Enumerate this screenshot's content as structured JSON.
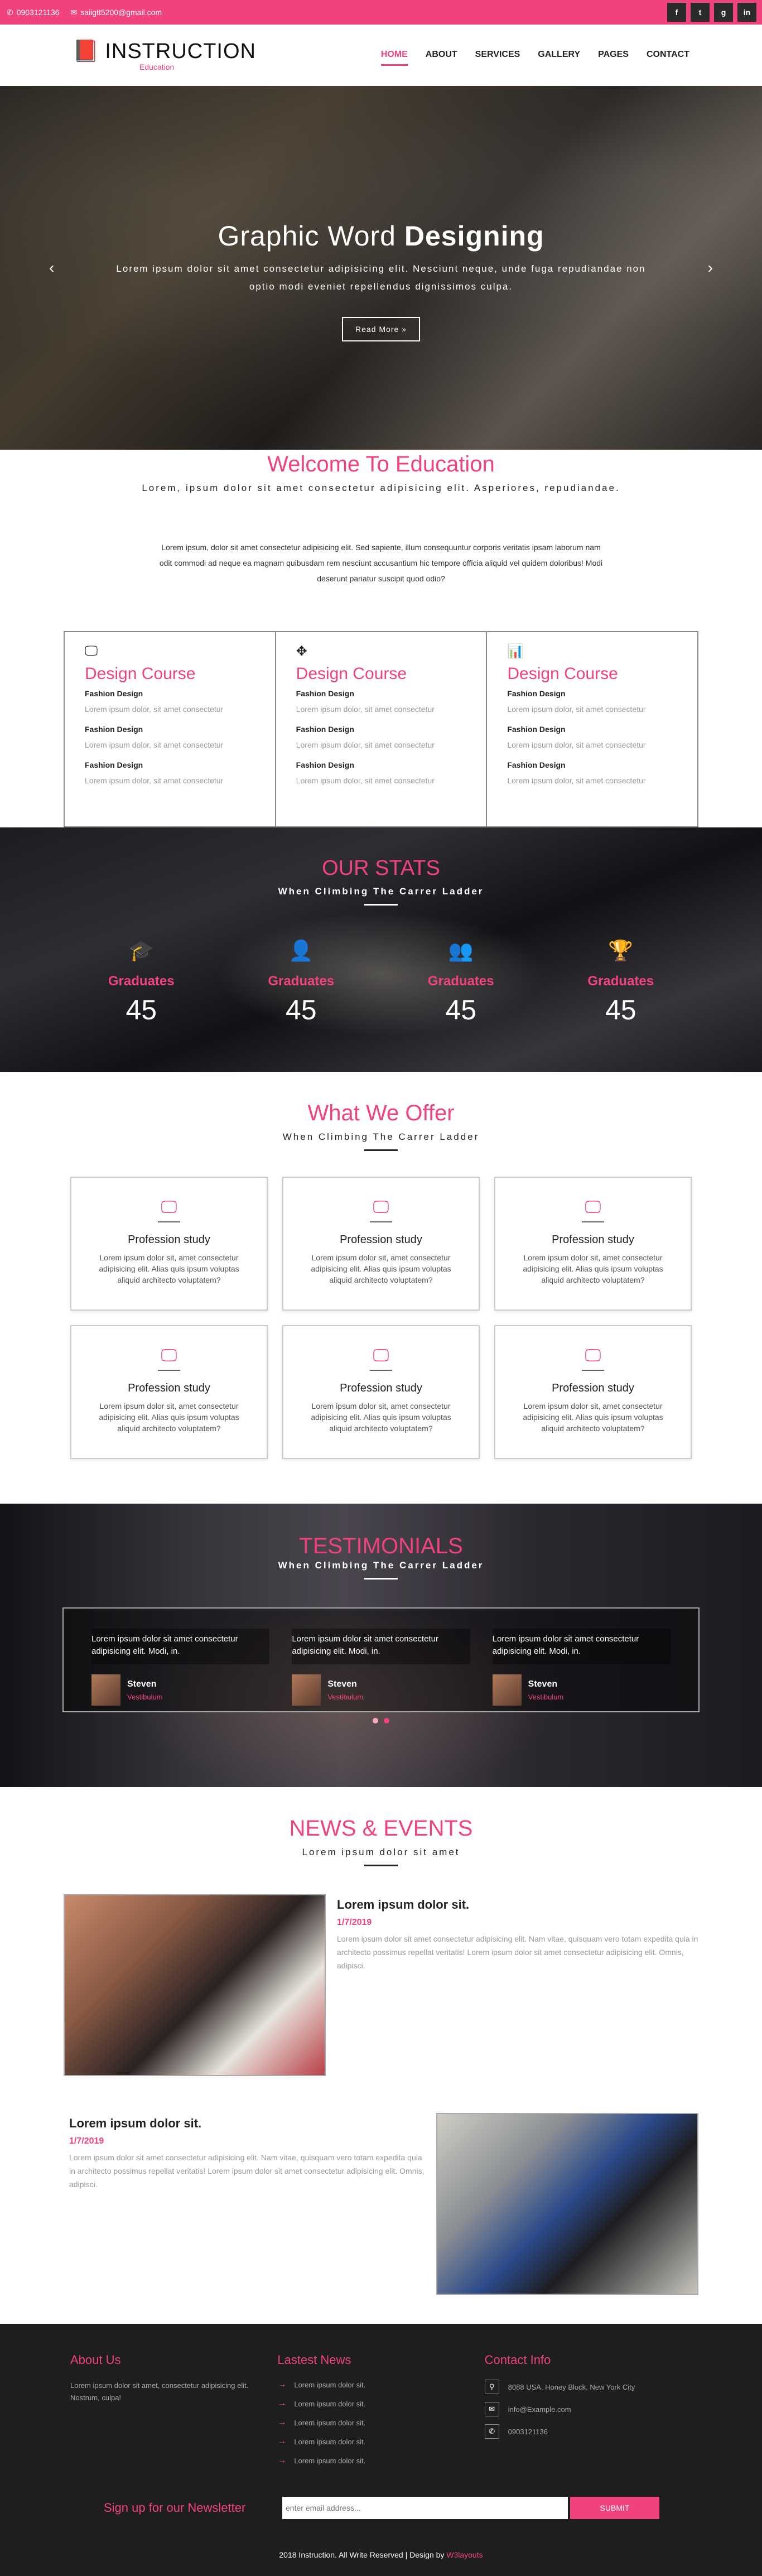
{
  "topbar": {
    "phone": "0903121136",
    "email": "saiigtt5200@gmail.com"
  },
  "social": [
    "f",
    "t",
    "g",
    "in"
  ],
  "logo": {
    "title": "INSTRUCTION",
    "subtitle": "Education"
  },
  "nav": [
    "HOME",
    "ABOUT",
    "SERVICES",
    "GALLERY",
    "PAGES",
    "CONTACT"
  ],
  "hero": {
    "title_a": "Graphic Word",
    "title_b": "Designing",
    "text": "Lorem ipsum dolor sit amet consectetur adipisicing elit. Nesciunt neque, unde fuga repudiandae non optio modi eveniet repellendus dignissimos culpa.",
    "button": "Read More »"
  },
  "welcome": {
    "title": "Welcome To Education",
    "tag": "Lorem, ipsum dolor sit amet consectetur adipisicing elit. Asperiores, repudiandae.",
    "desc": "Lorem ipsum, dolor sit amet consectetur adipisicing elit. Sed sapiente, illum consequuntur corporis veritatis ipsam laborum nam odit commodi ad neque ea magnam quibusdam rem nesciunt accusantium hic tempore officia aliquid vel quidem doloribus! Modi deserunt pariatur suscipit quod odio?"
  },
  "courses": [
    {
      "title": "Design Course",
      "items": [
        {
          "name": "Fashion Design",
          "text": "Lorem ipsum dolor, sit amet consectetur"
        },
        {
          "name": "Fashion Design",
          "text": "Lorem ipsum dolor, sit amet consectetur"
        },
        {
          "name": "Fashion Design",
          "text": "Lorem ipsum dolor, sit amet consectetur"
        }
      ]
    },
    {
      "title": "Design Course",
      "items": [
        {
          "name": "Fashion Design",
          "text": "Lorem ipsum dolor, sit amet consectetur"
        },
        {
          "name": "Fashion Design",
          "text": "Lorem ipsum dolor, sit amet consectetur"
        },
        {
          "name": "Fashion Design",
          "text": "Lorem ipsum dolor, sit amet consectetur"
        }
      ]
    },
    {
      "title": "Design Course",
      "items": [
        {
          "name": "Fashion Design",
          "text": "Lorem ipsum dolor, sit amet consectetur"
        },
        {
          "name": "Fashion Design",
          "text": "Lorem ipsum dolor, sit amet consectetur"
        },
        {
          "name": "Fashion Design",
          "text": "Lorem ipsum dolor, sit amet consectetur"
        }
      ]
    }
  ],
  "stats": {
    "title": "OUR STATS",
    "tag": "When Climbing The Carrer Ladder",
    "items": [
      {
        "label": "Graduates",
        "value": "45"
      },
      {
        "label": "Graduates",
        "value": "45"
      },
      {
        "label": "Graduates",
        "value": "45"
      },
      {
        "label": "Graduates",
        "value": "45"
      }
    ]
  },
  "offer": {
    "title": "What We Offer",
    "tag": "When Climbing The Carrer Ladder",
    "cards": [
      {
        "title": "Profession study",
        "text": "Lorem ipsum dolor sit, amet consectetur adipisicing elit. Alias quis ipsum voluptas aliquid architecto voluptatem?"
      },
      {
        "title": "Profession study",
        "text": "Lorem ipsum dolor sit, amet consectetur adipisicing elit. Alias quis ipsum voluptas aliquid architecto voluptatem?"
      },
      {
        "title": "Profession study",
        "text": "Lorem ipsum dolor sit, amet consectetur adipisicing elit. Alias quis ipsum voluptas aliquid architecto voluptatem?"
      },
      {
        "title": "Profession study",
        "text": "Lorem ipsum dolor sit, amet consectetur adipisicing elit. Alias quis ipsum voluptas aliquid architecto voluptatem?"
      },
      {
        "title": "Profession study",
        "text": "Lorem ipsum dolor sit, amet consectetur adipisicing elit. Alias quis ipsum voluptas aliquid architecto voluptatem?"
      },
      {
        "title": "Profession study",
        "text": "Lorem ipsum dolor sit, amet consectetur adipisicing elit. Alias quis ipsum voluptas aliquid architecto voluptatem?"
      }
    ]
  },
  "testimonials": {
    "title": "TESTIMONIALS",
    "tag": "When Climbing The Carrer Ladder",
    "items": [
      {
        "quote": "Lorem ipsum dolor sit amet consectetur adipisicing elit. Modi, in.",
        "name": "Steven",
        "role": "Vestibulum"
      },
      {
        "quote": "Lorem ipsum dolor sit amet consectetur adipisicing elit. Modi, in.",
        "name": "Steven",
        "role": "Vestibulum"
      },
      {
        "quote": "Lorem ipsum dolor sit amet consectetur adipisicing elit. Modi, in.",
        "name": "Steven",
        "role": "Vestibulum"
      }
    ]
  },
  "news": {
    "title": "NEWS & EVENTS",
    "tag": "Lorem ipsum dolor sit amet",
    "items": [
      {
        "title": "Lorem ipsum dolor sit.",
        "date": "1/7/2019",
        "text": "Lorem ipsum dolor sit amet consectetur adipisicing elit. Nam vitae, quisquam vero totam expedita quia in architecto possimus repellat veritatis! Lorem ipsum dolor sit amet consectetur adipisicing elit. Omnis, adipisci."
      },
      {
        "title": "Lorem ipsum dolor sit.",
        "date": "1/7/2019",
        "text": "Lorem ipsum dolor sit amet consectetur adipisicing elit. Nam vitae, quisquam vero totam expedita quia in architecto possimus repellat veritatis! Lorem ipsum dolor sit amet consectetur adipisicing elit. Omnis, adipisci."
      }
    ]
  },
  "footer": {
    "about_title": "About Us",
    "about_text": "Lorem ipsum dolor sit amet, consectetur adipisicing elit. Nostrum, culpa!",
    "latest_title": "Lastest News",
    "latest": [
      "Lorem ipsum dolor sit.",
      "Lorem ipsum dolor sit.",
      "Lorem ipsum dolor sit.",
      "Lorem ipsum dolor sit.",
      "Lorem ipsum dolor sit."
    ],
    "contact_title": "Contact Info",
    "address": "8088 USA, Honey Block, New York City",
    "email": "info@Example.com",
    "phone": "0903121136",
    "newsletter_label": "Sign up for our Newsletter",
    "newsletter_placeholder": "enter email address...",
    "submit": "SUBMIT",
    "copyright": "2018 Instruction. All Write Reserved | Design by",
    "designer": "W3layouts"
  }
}
